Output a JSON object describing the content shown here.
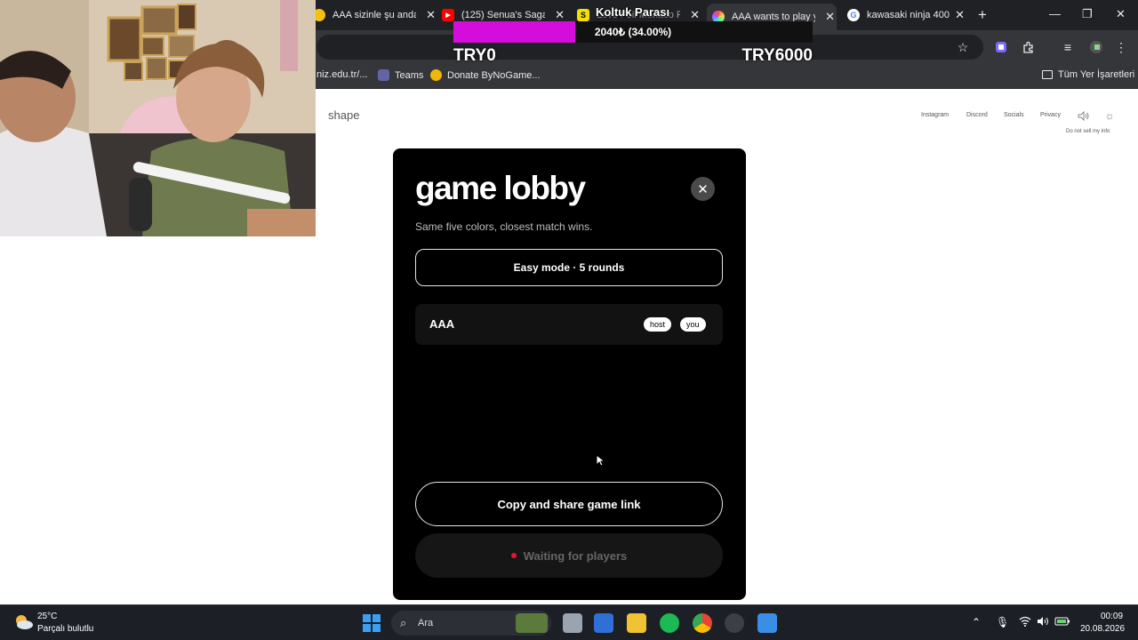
{
  "browser": {
    "tabs": [
      {
        "title": "AAA sizinle şu anda c",
        "active": false
      },
      {
        "title": "(125) Senua's Saga: I",
        "active": false
      },
      {
        "title": "Love Foil Monaco F",
        "active": false
      },
      {
        "title": "AAA wants to play yo",
        "active": true
      },
      {
        "title": "kawasaki ninja 400 -",
        "active": false
      }
    ],
    "bookmarks": [
      {
        "label": "niz.edu.tr/..."
      },
      {
        "label": "Teams"
      },
      {
        "label": "Donate ByNoGame..."
      }
    ],
    "all_bookmarks_label": "Tüm Yer İşaretleri"
  },
  "donation_overlay": {
    "title": "Koltuk Parası",
    "amount_text": "2040₺ (34.00%)",
    "progress_fraction": 0.34,
    "min_label": "TRY0",
    "max_label": "TRY6000",
    "fill_color": "#d40ddc"
  },
  "page": {
    "logo": "shape",
    "nav": {
      "instagram": "Instagram",
      "discord": "Discord",
      "socials": "Socials",
      "privacy": "Privacy",
      "do_not_sell": "Do not sell my info"
    }
  },
  "modal": {
    "title": "game lobby",
    "subtitle": "Same five colors, closest match wins.",
    "mode_button": "Easy mode · 5 rounds",
    "players": [
      {
        "name": "AAA",
        "badges": [
          "host",
          "you"
        ]
      }
    ],
    "share_button": "Copy and share game link",
    "waiting_button": "Waiting for players",
    "waiting_dot_color": "#e0192c"
  },
  "taskbar": {
    "weather_temp": "25°C",
    "weather_desc": "Parçalı bulutlu",
    "search_label": "Ara",
    "time": "00:09",
    "date": "20.08.2026"
  }
}
